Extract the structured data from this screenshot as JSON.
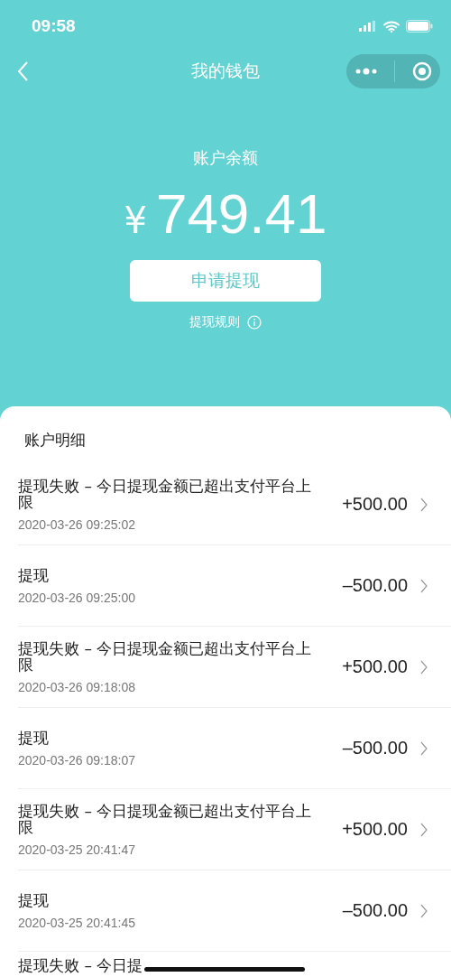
{
  "status_bar": {
    "time": "09:58"
  },
  "nav": {
    "title": "我的钱包"
  },
  "balance": {
    "label": "账户余额",
    "currency": "¥",
    "amount": "749.41"
  },
  "withdraw_button": "申请提现",
  "rules_link": "提现规则",
  "details": {
    "title": "账户明细",
    "rows": [
      {
        "title": "提现失败 – 今日提现金额已超出支付平台上限",
        "time": "2020-03-26 09:25:02",
        "amount": "+500.00"
      },
      {
        "title": "提现",
        "time": "2020-03-26 09:25:00",
        "amount": "–500.00"
      },
      {
        "title": "提现失败 – 今日提现金额已超出支付平台上限",
        "time": "2020-03-26 09:18:08",
        "amount": "+500.00"
      },
      {
        "title": "提现",
        "time": "2020-03-26 09:18:07",
        "amount": "–500.00"
      },
      {
        "title": "提现失败 – 今日提现金额已超出支付平台上限",
        "time": "2020-03-25 20:41:47",
        "amount": "+500.00"
      },
      {
        "title": "提现",
        "time": "2020-03-25 20:41:45",
        "amount": "–500.00"
      }
    ],
    "partial_row": {
      "title": "提现失败 – 今日提"
    }
  }
}
